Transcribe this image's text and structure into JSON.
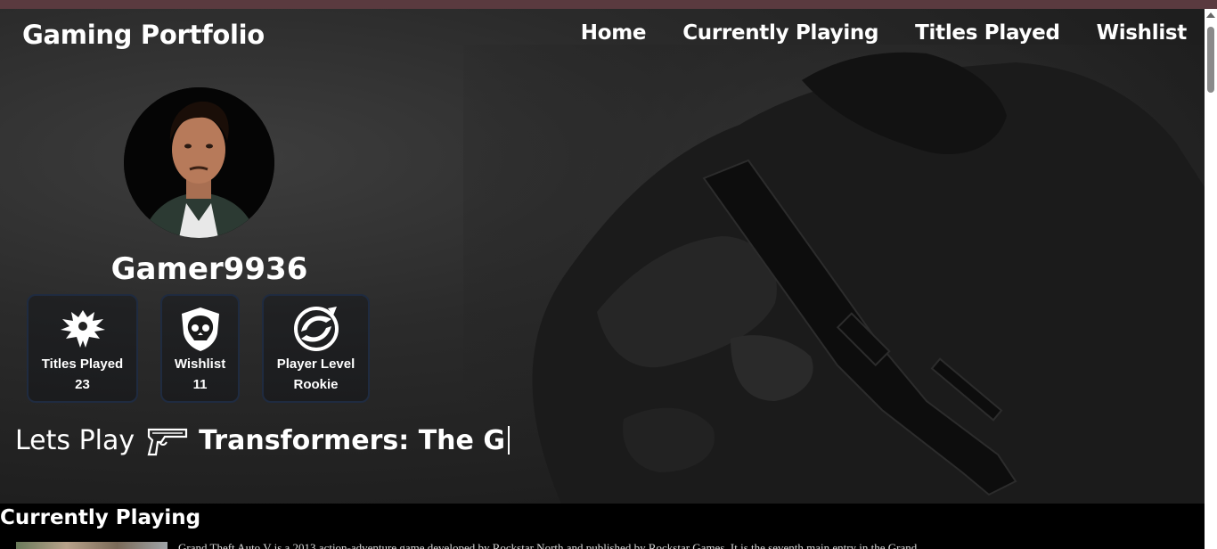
{
  "nav": {
    "brand": "Gaming Portfolio",
    "links": [
      "Home",
      "Currently Playing",
      "Titles Played",
      "Wishlist"
    ]
  },
  "profile": {
    "username": "Gamer9936",
    "avatar_icon": "profile-photo"
  },
  "stats": [
    {
      "label": "Titles Played",
      "value": "23",
      "icon": "phoenix-emblem-icon"
    },
    {
      "label": "Wishlist",
      "value": "11",
      "icon": "skull-shield-icon"
    },
    {
      "label": "Player Level",
      "value": "Rookie",
      "icon": "swirl-emblem-icon"
    }
  ],
  "hero": {
    "lets_play": "Lets Play",
    "typed_game": "Transformers: The G",
    "gun_icon": "pistol-icon"
  },
  "currently_playing": {
    "title": "Currently Playing",
    "description": "Grand Theft Auto V is a 2013 action-adventure game developed by Rockstar North and published by Rockstar Games. It is the seventh main entry in the Grand"
  },
  "colors": {
    "topbar": "#5a3a3f",
    "stat_border": "#1f2b40",
    "background": "#000000"
  }
}
